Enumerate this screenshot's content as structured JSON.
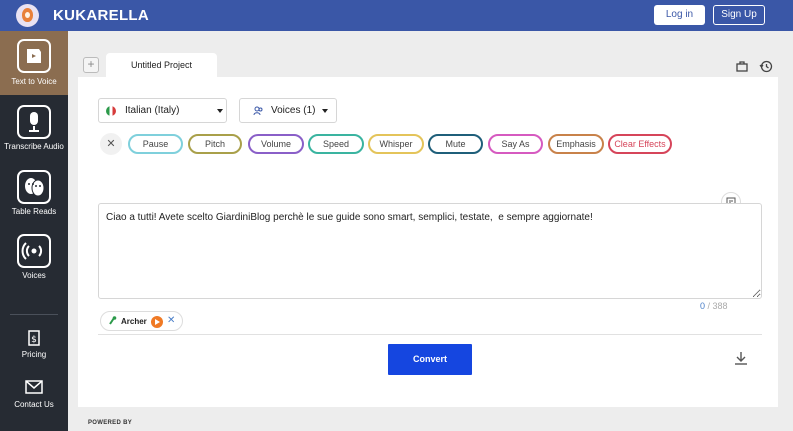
{
  "app": {
    "brand": "KUKARELLA"
  },
  "header": {
    "login_label": "Log in",
    "signup_label": "Sign Up"
  },
  "sidebar": {
    "items": [
      {
        "label": "Text to Voice",
        "icon": "speech-bubble-icon",
        "active": true
      },
      {
        "label": "Transcribe Audio",
        "icon": "microphone-icon",
        "active": false
      },
      {
        "label": "Table Reads",
        "icon": "theater-masks-icon",
        "active": false
      },
      {
        "label": "Voices",
        "icon": "broadcast-icon",
        "active": false
      },
      {
        "label": "Pricing",
        "icon": "price-tag-icon",
        "active": false
      },
      {
        "label": "Contact Us",
        "icon": "envelope-icon",
        "active": false
      }
    ],
    "active_color": "#8b6d50"
  },
  "tabs": {
    "add_label": "+",
    "active_label": "Untitled Project"
  },
  "controls": {
    "language": "Italian (Italy)",
    "voices": "Voices (1)"
  },
  "effects": [
    {
      "label": "Pause",
      "color": "#7fd0dc"
    },
    {
      "label": "Pitch",
      "color": "#a9a04a"
    },
    {
      "label": "Volume",
      "color": "#8a5fc8"
    },
    {
      "label": "Speed",
      "color": "#3ab4a0"
    },
    {
      "label": "Whisper",
      "color": "#e4c45a"
    },
    {
      "label": "Mute",
      "color": "#1f5f7a"
    },
    {
      "label": "Say As",
      "color": "#d65ac0"
    },
    {
      "label": "Emphasis",
      "color": "#c8824a"
    },
    {
      "label": "Clear Effects",
      "color": "#d6455a"
    }
  ],
  "editor": {
    "text": "Ciao a tutti! Avete scelto GiardiniBlog perchè le sue guide sono smart, semplici, testate,  e sempre aggiornate!",
    "counter_current": "0",
    "counter_sep": " / ",
    "counter_max": "388"
  },
  "voice_chip": {
    "name": "Archer"
  },
  "actions": {
    "convert_label": "Convert"
  },
  "footer": {
    "powered_by": "POWERED BY"
  },
  "colors": {
    "header": "#3a57a7",
    "convert": "#1546e0",
    "sidebar": "#262b33"
  }
}
